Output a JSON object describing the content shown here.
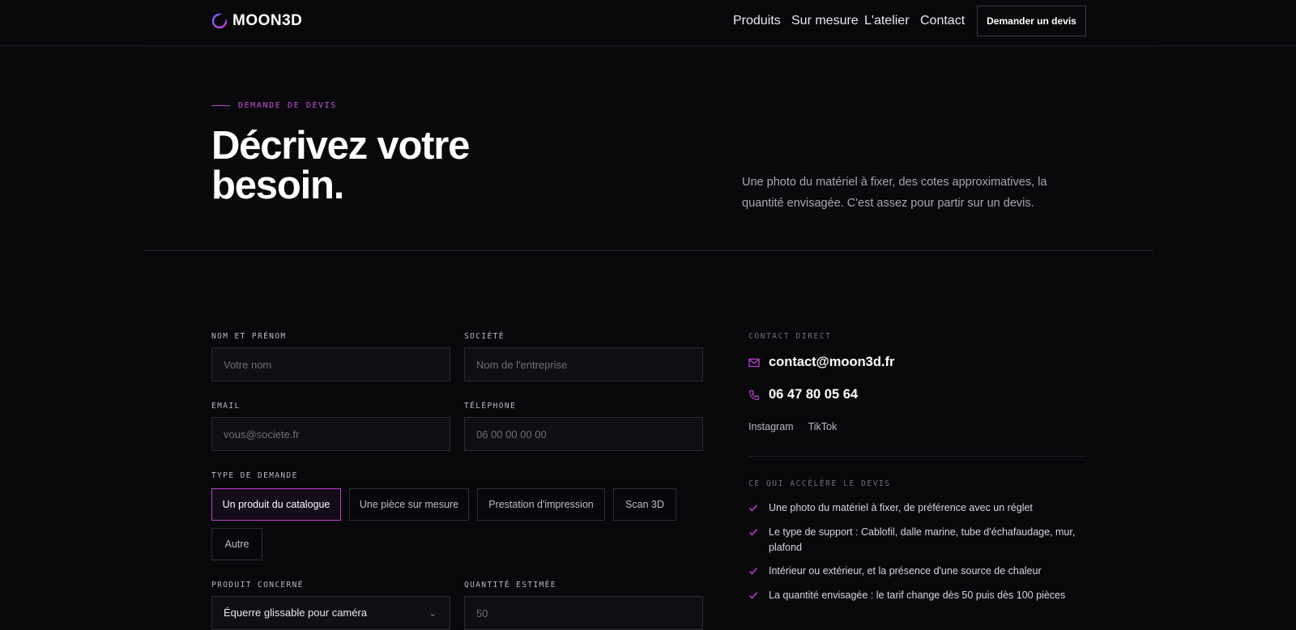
{
  "brand": {
    "name": "MOON3D",
    "accent": "#c03fd0"
  },
  "nav": {
    "items": [
      {
        "label": "Produits",
        "active": false
      },
      {
        "label": "Sur mesure",
        "active": false
      },
      {
        "label": "L'atelier",
        "active": false
      },
      {
        "label": "Contact",
        "active": true
      }
    ],
    "cta_label": "Demander un devis"
  },
  "hero": {
    "eyebrow": "DEMANDE DE DEVIS",
    "title_line1": "Décrivez votre",
    "title_line2": "besoin.",
    "description": "Une photo du matériel à fixer, des cotes approximatives, la quantité envisagée. C'est assez pour partir sur un devis."
  },
  "form": {
    "name": {
      "label": "NOM ET PRÉNOM",
      "placeholder": "Votre nom",
      "value": ""
    },
    "company": {
      "label": "SOCIÉTÉ",
      "placeholder": "Nom de l'entreprise",
      "value": ""
    },
    "email": {
      "label": "EMAIL",
      "placeholder": "vous@societe.fr",
      "value": ""
    },
    "phone": {
      "label": "TÉLÉPHONE",
      "placeholder": "06 00 00 00 00",
      "value": ""
    },
    "request_type": {
      "label": "TYPE DE DEMANDE",
      "options": [
        {
          "label": "Un produit du catalogue",
          "selected": true
        },
        {
          "label": "Une pièce sur mesure",
          "selected": false
        },
        {
          "label": "Prestation d'impression",
          "selected": false
        },
        {
          "label": "Scan 3D",
          "selected": false
        },
        {
          "label": "Autre",
          "selected": false
        }
      ]
    },
    "product": {
      "label": "PRODUIT CONCERNÉ",
      "value": "Équerre glissable pour caméra"
    },
    "quantity": {
      "label": "QUANTITÉ ESTIMÉE",
      "placeholder": "50",
      "value": ""
    }
  },
  "sidebar": {
    "contact_label": "CONTACT DIRECT",
    "email": "contact@moon3d.fr",
    "phone": "06 47 80 05 64",
    "socials": [
      "Instagram",
      "TikTok"
    ],
    "tips_label": "CE QUI ACCÉLÈRE LE DEVIS",
    "tips": [
      "Une photo du matériel à fixer, de préférence avec un réglet",
      "Le type de support : Cablofil, dalle marine, tube d'échafaudage, mur, plafond",
      "Intérieur ou extérieur, et la présence d'une source de chaleur",
      "La quantité envisagée : le tarif change dès 50 puis dès 100 pièces"
    ],
    "icons": {
      "email": "mail-icon",
      "phone": "phone-icon",
      "tip": "check-icon"
    }
  }
}
